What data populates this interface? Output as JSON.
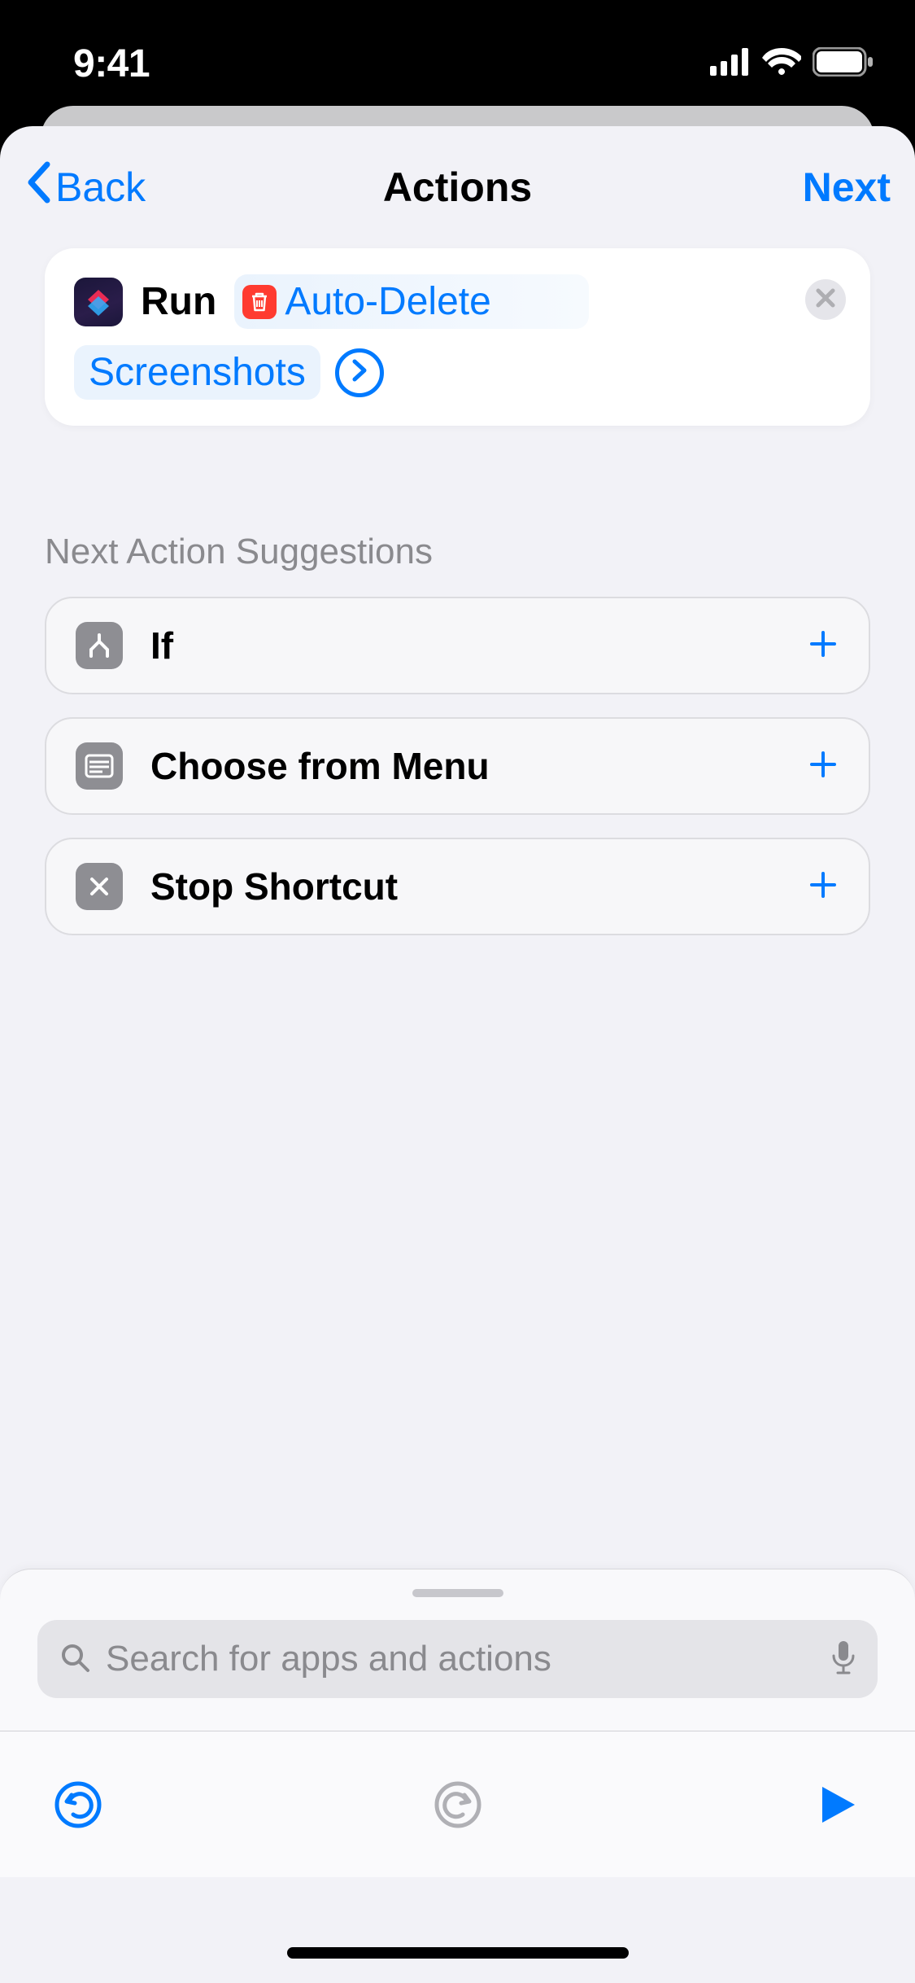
{
  "statusbar": {
    "time": "9:41"
  },
  "nav": {
    "back_label": "Back",
    "title": "Actions",
    "next_label": "Next"
  },
  "action": {
    "run_label": "Run",
    "shortcut_name": "Auto-Delete",
    "screenshots_label": "Screenshots"
  },
  "suggestions": {
    "header": "Next Action Suggestions",
    "items": [
      {
        "label": "If"
      },
      {
        "label": "Choose from Menu"
      },
      {
        "label": "Stop Shortcut"
      }
    ]
  },
  "search": {
    "placeholder": "Search for apps and actions"
  }
}
